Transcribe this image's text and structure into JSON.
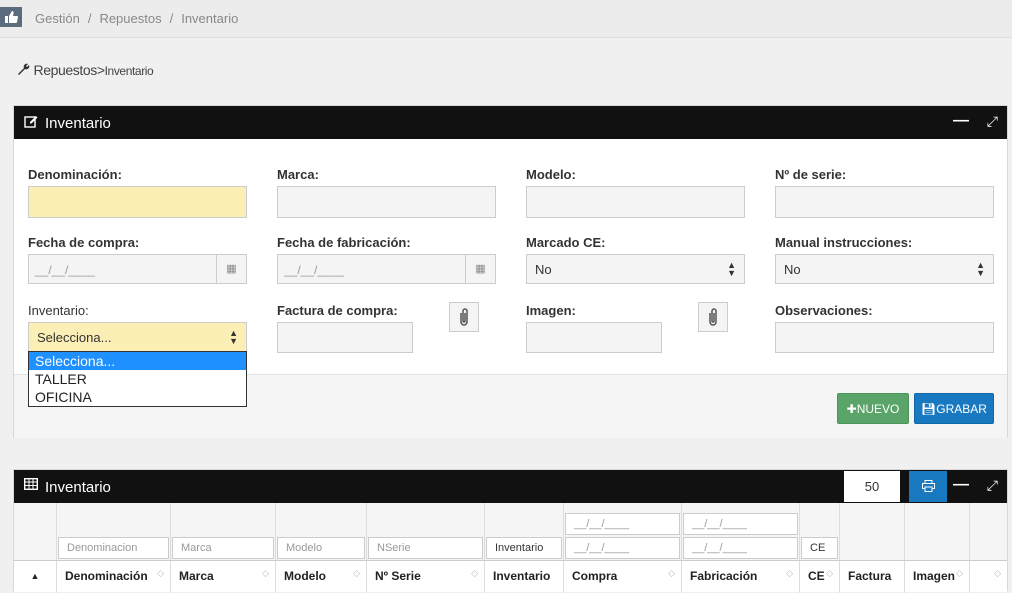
{
  "breadcrumb": {
    "home_icon": "thumbs-up-icon",
    "items": [
      "Gestión",
      "Repuestos",
      "Inventario"
    ],
    "separator": "/"
  },
  "subheader": {
    "icon": "wrench-icon",
    "part1": "Repuestos",
    "sep": ">",
    "part2": "Inventario"
  },
  "form_panel": {
    "title": "Inventario",
    "icon": "edit-icon",
    "fields": {
      "denominacion": {
        "label": "Denominación:",
        "value": ""
      },
      "marca": {
        "label": "Marca:",
        "value": ""
      },
      "modelo": {
        "label": "Modelo:",
        "value": ""
      },
      "nserie": {
        "label": "Nº de serie:",
        "value": ""
      },
      "fecha_compra": {
        "label": "Fecha de compra:",
        "placeholder": "__/__/____"
      },
      "fecha_fabricacion": {
        "label": "Fecha de fabricación:",
        "placeholder": "__/__/____"
      },
      "marcado_ce": {
        "label": "Marcado CE:",
        "value": "No"
      },
      "manual": {
        "label": "Manual instrucciones:",
        "value": "No"
      },
      "inventario": {
        "label": "Inventario:",
        "value": "Selecciona...",
        "options": [
          "Selecciona...",
          "TALLER",
          "OFICINA"
        ]
      },
      "factura": {
        "label": "Factura de compra:"
      },
      "imagen": {
        "label": "Imagen:"
      },
      "observaciones": {
        "label": "Observaciones:"
      }
    },
    "buttons": {
      "nuevo": "NUEVO",
      "grabar": "GRABAR"
    }
  },
  "table_panel": {
    "title": "Inventario",
    "icon": "table-icon",
    "page_size": "50",
    "filters": {
      "denominacion": "Denominacion",
      "marca": "Marca",
      "modelo": "Modelo",
      "nserie": "NSerie",
      "inventario": "Inventario",
      "compra_from": "__/__/____",
      "compra_to": "__/__/____",
      "fab_from": "__/__/____",
      "fab_to": "__/__/____",
      "ce": "CE"
    },
    "columns": [
      "Denominación",
      "Marca",
      "Modelo",
      "Nº Serie",
      "Inventario",
      "Compra",
      "Fabricación",
      "CE",
      "Factura",
      "Imagen",
      ""
    ]
  }
}
